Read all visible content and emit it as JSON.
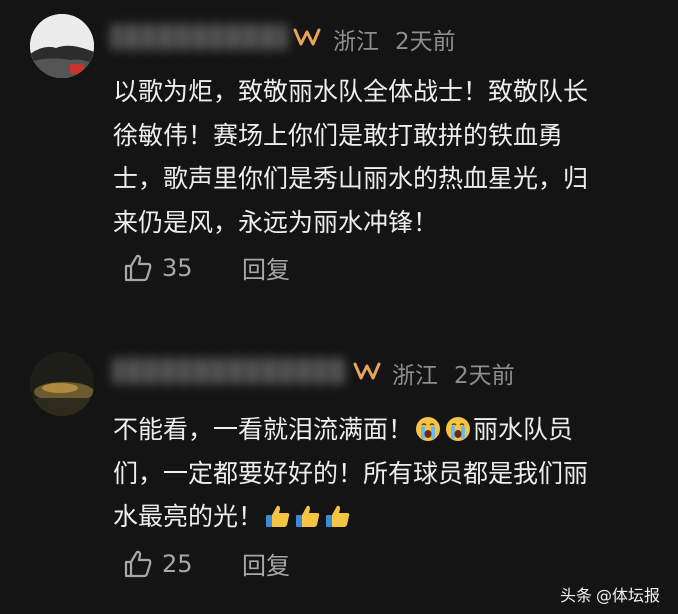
{
  "comments": [
    {
      "location": "浙江",
      "time": "2天前",
      "lines": [
        "以歌为炬，致敬丽水队全体战士！致敬队长",
        "徐敏伟！赛场上你们是敢打敢拼的铁血勇",
        "士，歌声里你们是秀山丽水的热血星光，归",
        "来仍是风，永远为丽水冲锋！"
      ],
      "likes": "35",
      "reply_label": "回复"
    },
    {
      "location": "浙江",
      "time": "2天前",
      "line1_a": "不能看，一看就泪流满面！",
      "line1_b": "丽水队员",
      "line2": "们，一定都要好好的！所有球员都是我们丽",
      "line3": "水最亮的光！",
      "likes": "25",
      "reply_label": "回复"
    }
  ],
  "watermark": {
    "brand": "头条",
    "account": "@体坛报"
  },
  "colors": {
    "background": "#141414",
    "badge_orange": "#e8a35a",
    "text_primary": "#ededed",
    "text_meta": "#8d8d8d"
  },
  "icons": [
    "like-icon",
    "vip-badge-icon",
    "crying-face-emoji",
    "thumbs-up-emoji"
  ]
}
